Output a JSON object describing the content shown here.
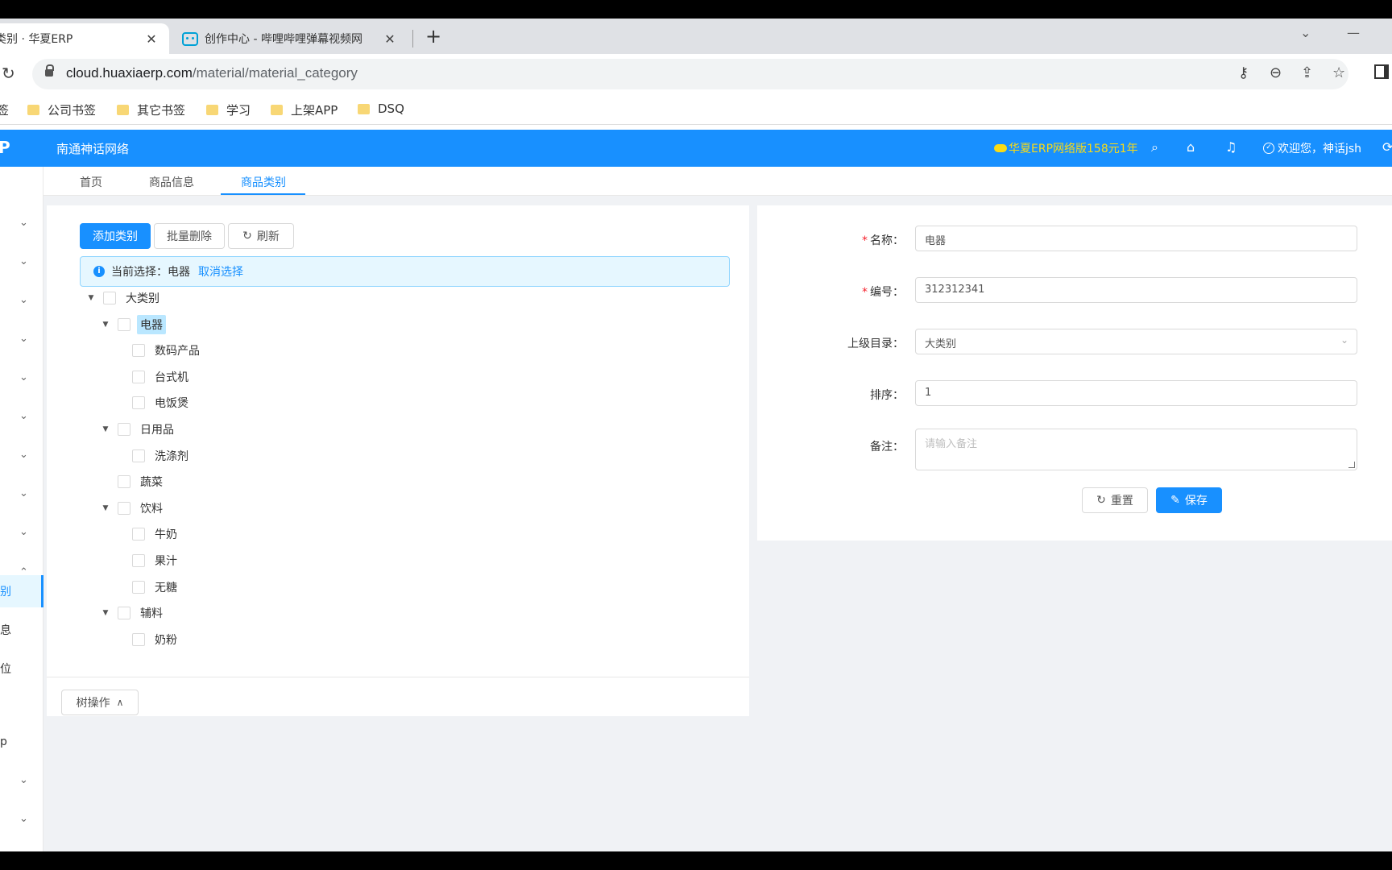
{
  "browser": {
    "tabs": [
      {
        "title": "类别 · 华夏ERP",
        "close": "✕"
      },
      {
        "title": "创作中心 - 哔哩哔哩弹幕视频网",
        "close": "✕"
      }
    ],
    "new_tab": "+",
    "url_domain": "cloud.huaxiaerp.com",
    "url_path": "/material/material_category",
    "bookmarks": [
      "签",
      "公司书签",
      "其它书签",
      "学习",
      "上架APP",
      "DSQ"
    ]
  },
  "app": {
    "logo": "P",
    "company": "南通神话网络",
    "promo": "华夏ERP网络版158元1年",
    "welcome": "欢迎您，神话jsh"
  },
  "sidebar": {
    "items": [
      "别",
      "息",
      "位",
      "p"
    ]
  },
  "page_tabs": [
    "首页",
    "商品信息",
    "商品类别"
  ],
  "toolbar": {
    "add": "添加类别",
    "batch_delete": "批量删除",
    "refresh": "刷新"
  },
  "alert": {
    "prefix": "当前选择：",
    "value": "电器",
    "cancel": "取消选择"
  },
  "tree": [
    {
      "label": "大类别",
      "level": 0,
      "expanded": true,
      "selected": false
    },
    {
      "label": "电器",
      "level": 1,
      "expanded": true,
      "selected": true
    },
    {
      "label": "数码产品",
      "level": 2,
      "expanded": false,
      "selected": false
    },
    {
      "label": "台式机",
      "level": 2,
      "expanded": false,
      "selected": false
    },
    {
      "label": "电饭煲",
      "level": 2,
      "expanded": false,
      "selected": false
    },
    {
      "label": "日用品",
      "level": 1,
      "expanded": true,
      "selected": false
    },
    {
      "label": "洗涤剂",
      "level": 2,
      "expanded": false,
      "selected": false
    },
    {
      "label": "蔬菜",
      "level": 1,
      "expanded": false,
      "selected": false
    },
    {
      "label": "饮料",
      "level": 1,
      "expanded": true,
      "selected": false
    },
    {
      "label": "牛奶",
      "level": 2,
      "expanded": false,
      "selected": false
    },
    {
      "label": "果汁",
      "level": 2,
      "expanded": false,
      "selected": false
    },
    {
      "label": "无糖",
      "level": 2,
      "expanded": false,
      "selected": false
    },
    {
      "label": "辅料",
      "level": 1,
      "expanded": true,
      "selected": false
    },
    {
      "label": "奶粉",
      "level": 2,
      "expanded": false,
      "selected": false
    }
  ],
  "tree_ops": "树操作",
  "form": {
    "name_label": "名称",
    "name_value": "电器",
    "code_label": "编号",
    "code_value": "312312341",
    "parent_label": "上级目录",
    "parent_value": "大类别",
    "sort_label": "排序",
    "sort_value": "1",
    "remark_label": "备注",
    "remark_placeholder": "请输入备注",
    "colon": "：",
    "required_mark": "*",
    "reset": "重置",
    "save": "保存"
  },
  "colors": {
    "primary": "#1890ff",
    "promo": "#fadb14",
    "selected_bg": "#bae7ff"
  }
}
